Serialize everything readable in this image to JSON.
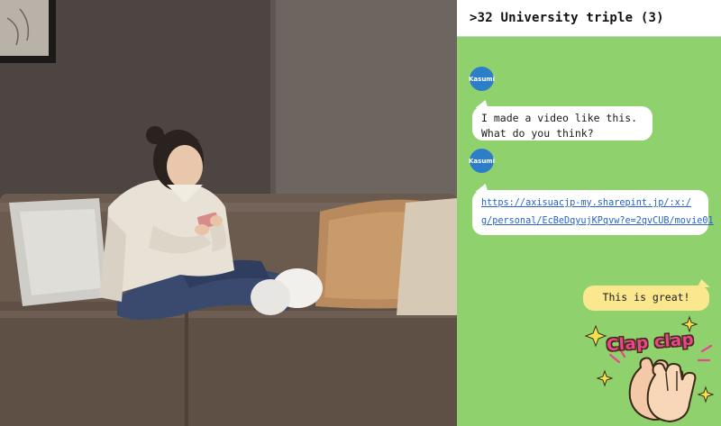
{
  "chat": {
    "title": ">32 University triple (3)",
    "messages": [
      {
        "sender": "Kasumi",
        "lines": [
          "I made a video like this.",
          "What do you think?"
        ]
      },
      {
        "sender": "Kasumi",
        "link_lines": [
          "https://axisuacjp-my.sharepint.jp/:x:/",
          "g/personal/EcBeDqyujKPqvw?e=2qvCUB/movie01"
        ]
      },
      {
        "sender": "me",
        "text": "This is great!"
      }
    ],
    "sticker": {
      "text": "Clap clap",
      "icon": "clapping-hands-icon"
    }
  },
  "colors": {
    "chat_background": "#8fd16c",
    "avatar": "#2d7ec8",
    "own_bubble": "#fbe88e",
    "link": "#2a62c9"
  }
}
